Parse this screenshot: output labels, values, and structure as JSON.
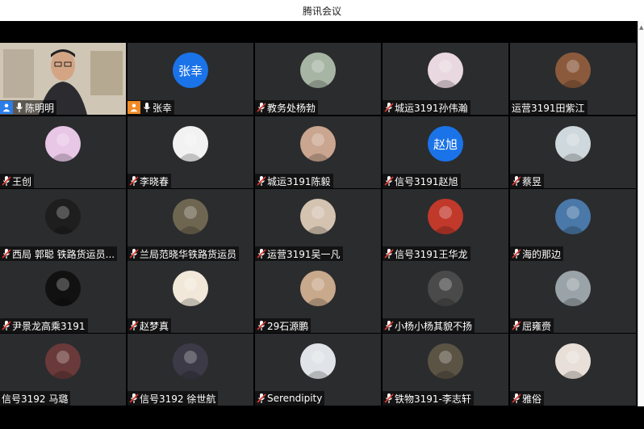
{
  "window": {
    "title": "腾讯会议"
  },
  "tiles": [
    {
      "name": "陈明明",
      "type": "video",
      "host": "blue",
      "mic": "on"
    },
    {
      "name": "张幸",
      "type": "text",
      "avatar_text": "张幸",
      "host": "orange",
      "mic": "on"
    },
    {
      "name": "教务处杨勃",
      "type": "photo",
      "bg": "#a7b5a4",
      "mic": "off"
    },
    {
      "name": "城运3191孙伟瀚",
      "type": "photo",
      "bg": "#e9d8df",
      "mic": "off"
    },
    {
      "name": "运营3191田紫江",
      "type": "photo",
      "bg": "#8b5a3c",
      "mic": "none"
    },
    {
      "name": "王创",
      "type": "photo",
      "bg": "#e8c6e6",
      "mic": "off"
    },
    {
      "name": "李晓春",
      "type": "photo",
      "bg": "#f2f2f2",
      "mic": "off"
    },
    {
      "name": "城运3191陈毅",
      "type": "photo",
      "bg": "#caa58f",
      "mic": "off"
    },
    {
      "name": "信号3191赵旭",
      "type": "text",
      "avatar_text": "赵旭",
      "mic": "off"
    },
    {
      "name": "蔡昱",
      "type": "photo",
      "bg": "#cfd8dc",
      "mic": "off"
    },
    {
      "name": "西局 郭聪 铁路货运员...",
      "type": "photo",
      "bg": "#1e1e1e",
      "mic": "off"
    },
    {
      "name": "兰局范晓华铁路货运员",
      "type": "photo",
      "bg": "#6e6650",
      "mic": "off"
    },
    {
      "name": "运营3191吴一凡",
      "type": "photo",
      "bg": "#d4c3b0",
      "mic": "off"
    },
    {
      "name": "信号3191王华龙",
      "type": "photo",
      "bg": "#c0392b",
      "mic": "off"
    },
    {
      "name": "海的那边",
      "type": "photo",
      "bg": "#4a78a8",
      "mic": "off"
    },
    {
      "name": "尹景龙高乘3191",
      "type": "photo",
      "bg": "#111111",
      "mic": "off"
    },
    {
      "name": "赵梦真",
      "type": "photo",
      "bg": "#f1e8da",
      "mic": "off"
    },
    {
      "name": "29石源鹏",
      "type": "photo",
      "bg": "#c9a98b",
      "mic": "off"
    },
    {
      "name": "小杨小杨其貌不扬",
      "type": "photo",
      "bg": "#4a4a4a",
      "mic": "off"
    },
    {
      "name": "屈雍赍",
      "type": "photo",
      "bg": "#9aa3a8",
      "mic": "off"
    },
    {
      "name": "信号3192 马璐",
      "type": "photo",
      "bg": "#6a3a3a",
      "mic": "none"
    },
    {
      "name": "信号3192 徐世航",
      "type": "photo",
      "bg": "#3d3a48",
      "mic": "off"
    },
    {
      "name": "Serendipity",
      "type": "photo",
      "bg": "#e0e4e8",
      "mic": "off"
    },
    {
      "name": "铁物3191-李志轩",
      "type": "photo",
      "bg": "#5b5344",
      "mic": "off"
    },
    {
      "name": "雅俗",
      "type": "photo",
      "bg": "#e8e0d8",
      "mic": "off"
    }
  ],
  "colors": {
    "tile_bg": "#2b2c2e",
    "mic_off": "#e53935",
    "host_blue": "#2b7de9",
    "host_orange": "#f08a24",
    "avatar_blue": "#1a73e8"
  }
}
